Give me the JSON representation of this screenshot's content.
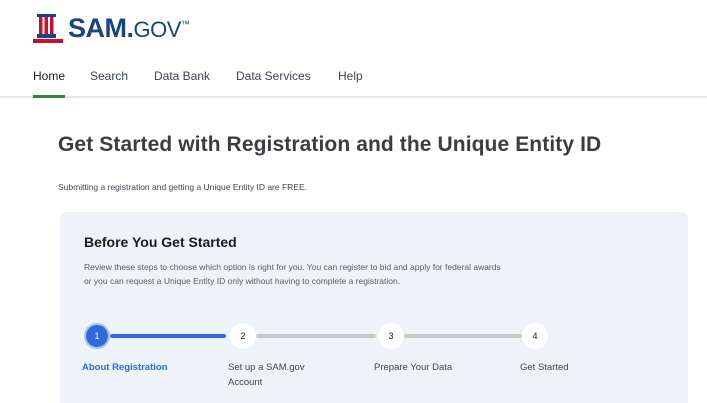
{
  "header": {
    "logo_text": "SAM.",
    "logo_gov": "GOV",
    "logo_tm": "™",
    "colors": {
      "brand_blue": "#1a4480",
      "brand_red": "#c8102e"
    }
  },
  "nav": {
    "items": [
      {
        "label": "Home",
        "active": true
      },
      {
        "label": "Search"
      },
      {
        "label": "Data Bank"
      },
      {
        "label": "Data Services"
      },
      {
        "label": "Help"
      }
    ],
    "active_color": "#2e8540"
  },
  "main": {
    "title": "Get Started with Registration and the Unique Entity ID",
    "subtitle": "Submitting a registration and getting a Unique Entity ID are FREE."
  },
  "card": {
    "title": "Before You Get Started",
    "description": "Review these steps to choose which option is right for you. You can register to bid and apply for federal awards or you can request a Unique Entity ID only without having to complete a registration.",
    "steps": [
      {
        "number": "1",
        "label": "About Registration",
        "active": true
      },
      {
        "number": "2",
        "label": "Set up a SAM.gov Account"
      },
      {
        "number": "3",
        "label": "Prepare Your Data"
      },
      {
        "number": "4",
        "label": "Get Started"
      }
    ],
    "colors": {
      "background": "#eef3f9",
      "step_active": "#2f6bdb",
      "step_inactive": "#c9c9c9"
    }
  }
}
